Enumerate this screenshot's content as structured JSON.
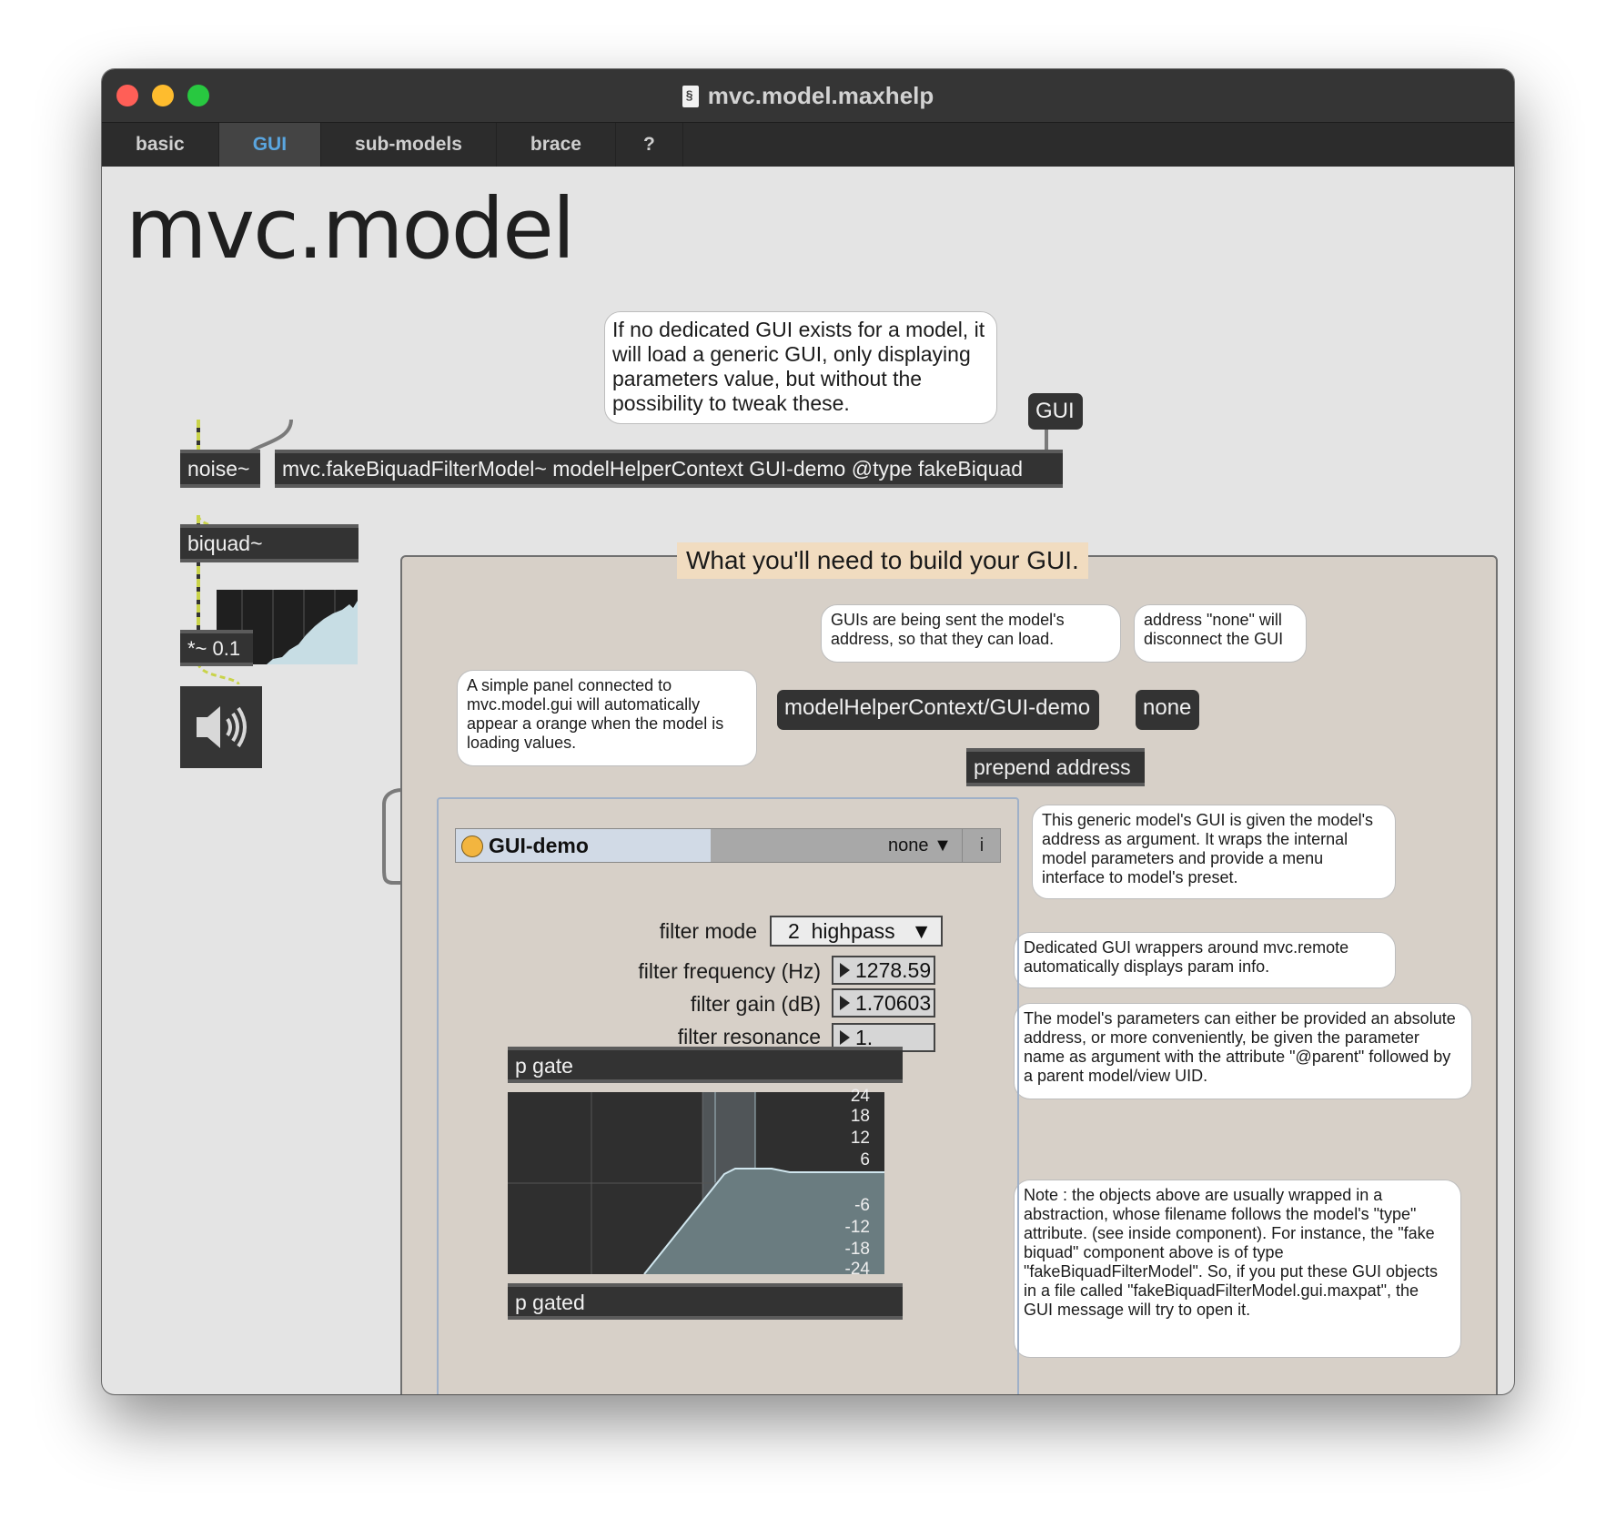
{
  "window": {
    "title": "mvc.model.maxhelp"
  },
  "tabs": [
    {
      "label": "basic"
    },
    {
      "label": "GUI"
    },
    {
      "label": "sub-models"
    },
    {
      "label": "brace"
    },
    {
      "label": "?"
    }
  ],
  "active_tab": "GUI",
  "page_title": "mvc.model",
  "comments": {
    "no_gui": "If no dedicated GUI exists for a model, it will load a generic GUI, only displaying parameters value, but without the possibility to tweak these.",
    "sent_address": "GUIs are being sent the model's address, so that they can load.",
    "address_none": "address \"none\" will disconnect the GUI",
    "simple_panel": "A simple panel connected to mvc.model.gui will automatically appear a orange when the model is loading values.",
    "generic_gui": "This generic model's GUI is given the model's address as argument. It wraps the internal model parameters and provide a menu interface to model's preset.",
    "dedicated_wrappers": "Dedicated GUI wrappers around mvc.remote automatically displays param info.",
    "parameters_address": "The model's parameters can either be provided an absolute address, or more conveniently, be given the parameter name as argument with the attribute \"@parent\" followed by a parent model/view UID.",
    "note": "Note :  the objects above are usually wrapped in a abstraction, whose filename follows the model's \"type\" attribute. (see inside component). For instance, the \"fake biquad\" component above is of type \"fakeBiquadFilterModel\". So, if you put these GUI objects in a file called \"fakeBiquadFilterModel.gui.maxpat\", the GUI message will try to open it."
  },
  "messages": {
    "gui": "GUI",
    "address": "modelHelperContext/GUI-demo",
    "none": "none"
  },
  "objects": {
    "noise": "noise~",
    "model": "mvc.fakeBiquadFilterModel~ modelHelperContext GUI-demo @type fakeBiquad",
    "biquad": "biquad~",
    "gain": "*~ 0.1",
    "prepend": "prepend address",
    "gate": "p gate",
    "gated": "p gated"
  },
  "panel_title": "What you'll need to build your GUI.",
  "model_gui": {
    "name": "GUI-demo",
    "preset": "none",
    "info_button": "i",
    "status_color": "#f3b53f"
  },
  "params": {
    "filter_mode": {
      "label": "filter mode",
      "index": "2",
      "value": "highpass"
    },
    "frequency": {
      "label": "filter frequency (Hz)",
      "value": "1278.59"
    },
    "gain": {
      "label": "filter gain (dB)",
      "value": "1.70603"
    },
    "resonance": {
      "label": "filter resonance",
      "value": "1."
    }
  },
  "filter_graph": {
    "y_labels": [
      "24",
      "18",
      "12",
      "6",
      "-6",
      "-12",
      "-18",
      "-24"
    ]
  },
  "colors": {
    "patch_cord_signal": "#c9d34a",
    "object_bg": "#333333",
    "panel_bg": "#d7d0c8",
    "active_tab_text": "#5aa6e0"
  }
}
